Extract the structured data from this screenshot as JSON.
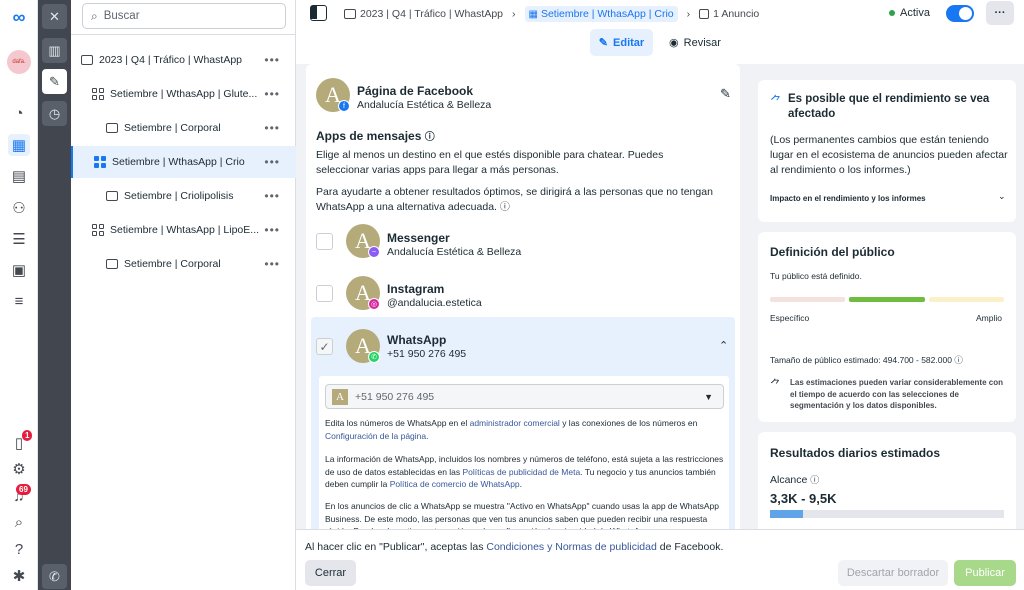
{
  "app": {
    "logo_label": "Meta",
    "account_avatar": "dafa."
  },
  "nav": {
    "notifications_badge": "1",
    "alerts_badge": "69"
  },
  "search": {
    "placeholder": "Buscar"
  },
  "tree": [
    {
      "label": "2023 | Q4 | Tráfico | WhastApp",
      "kind": "campaign",
      "indent": 0
    },
    {
      "label": "Setiembre | WthasApp | Glute...",
      "kind": "adset",
      "indent": 1
    },
    {
      "label": "Setiembre | Corporal",
      "kind": "ad",
      "indent": 2
    },
    {
      "label": "Setiembre | WthasApp | Crio",
      "kind": "adset",
      "indent": 1,
      "selected": true
    },
    {
      "label": "Setiembre | Criolipolisis",
      "kind": "ad",
      "indent": 2
    },
    {
      "label": "Setiembre | WhtasApp | LipoE...",
      "kind": "adset",
      "indent": 1
    },
    {
      "label": "Setiembre | Corporal",
      "kind": "ad",
      "indent": 2
    }
  ],
  "breadcrumb": {
    "campaign": "2023 | Q4 | Tráfico | WhastApp",
    "adset": "Setiembre | WthasApp | Crio",
    "ad": "1 Anuncio"
  },
  "status": {
    "label": "Activa",
    "enabled": true
  },
  "tabs": {
    "edit": "Editar",
    "review": "Revisar"
  },
  "page": {
    "title": "Página de Facebook",
    "name": "Andalucía Estética & Belleza"
  },
  "apps": {
    "title": "Apps de mensajes",
    "desc1": "Elige al menos un destino en el que estés disponible para chatear. Puedes seleccionar varias apps para llegar a más personas.",
    "desc2": "Para ayudarte a obtener resultados óptimos, se dirigirá a las personas que no tengan WhatsApp a una alternativa adecuada.",
    "items": [
      {
        "name": "Messenger",
        "detail": "Andalucía Estética & Belleza",
        "checked": false
      },
      {
        "name": "Instagram",
        "detail": "@andalucia.estetica",
        "checked": false
      },
      {
        "name": "WhatsApp",
        "detail": "+51 950 276 495",
        "checked": true
      }
    ],
    "phone_select": "+51 950 276 495",
    "info1_a": "Edita los números de WhatsApp en el ",
    "info1_link1": "administrador comercial",
    "info1_b": " y las conexiones de los números en ",
    "info1_link2": "Configuración de la página",
    "info1_c": ".",
    "info2_a": "La información de WhatsApp, incluidos los nombres y números de teléfono, está sujeta a las restricciones de uso de datos establecidas en las ",
    "info2_link1": "Políticas de publicidad de Meta",
    "info2_b": ". Tu negocio y tus anuncios también deben cumplir la ",
    "info2_link2": "Política de comercio de WhatsApp",
    "info2_c": ".",
    "info3": "En los anuncios de clic a WhatsApp se muestra \"Activo en WhatsApp\" cuando usas la app de WhatsApp Business. De este modo, las personas que ven tus anuncios saben que pueden recibir una respuesta rápida. Puedes desactivar esta opción en la configuración de privacidad de WhatsApp."
  },
  "performance": {
    "title": "Es posible que el rendimiento se vea afectado",
    "body": "(Los permanentes cambios que están teniendo lugar en el ecosistema de anuncios pueden afectar al rendimiento o los informes.)",
    "link": "Impacto en el rendimiento y los informes"
  },
  "audience": {
    "title": "Definición del público",
    "status": "Tu público está definido.",
    "left": "Específico",
    "right": "Amplio",
    "size": "Tamaño de público estimado: 494.700 - 582.000",
    "note": "Las estimaciones pueden variar considerablemente con el tiempo de acuerdo con las selecciones de segmentación y los datos disponibles."
  },
  "results": {
    "title": "Resultados diarios estimados",
    "reach_label": "Alcance",
    "reach_value": "3,3K - 9,5K",
    "reach_fill": 0.14
  },
  "footer": {
    "text_a": "Al hacer clic en \"Publicar\", aceptas las ",
    "link": "Condiciones y Normas de publicidad",
    "text_b": " de Facebook.",
    "close": "Cerrar",
    "discard": "Descartar borrador",
    "publish": "Publicar"
  },
  "colors": {
    "accent": "#1877f2",
    "active": "#31a24c",
    "publish": "#a8d88a",
    "gauge_green": "#6fbd3f"
  }
}
